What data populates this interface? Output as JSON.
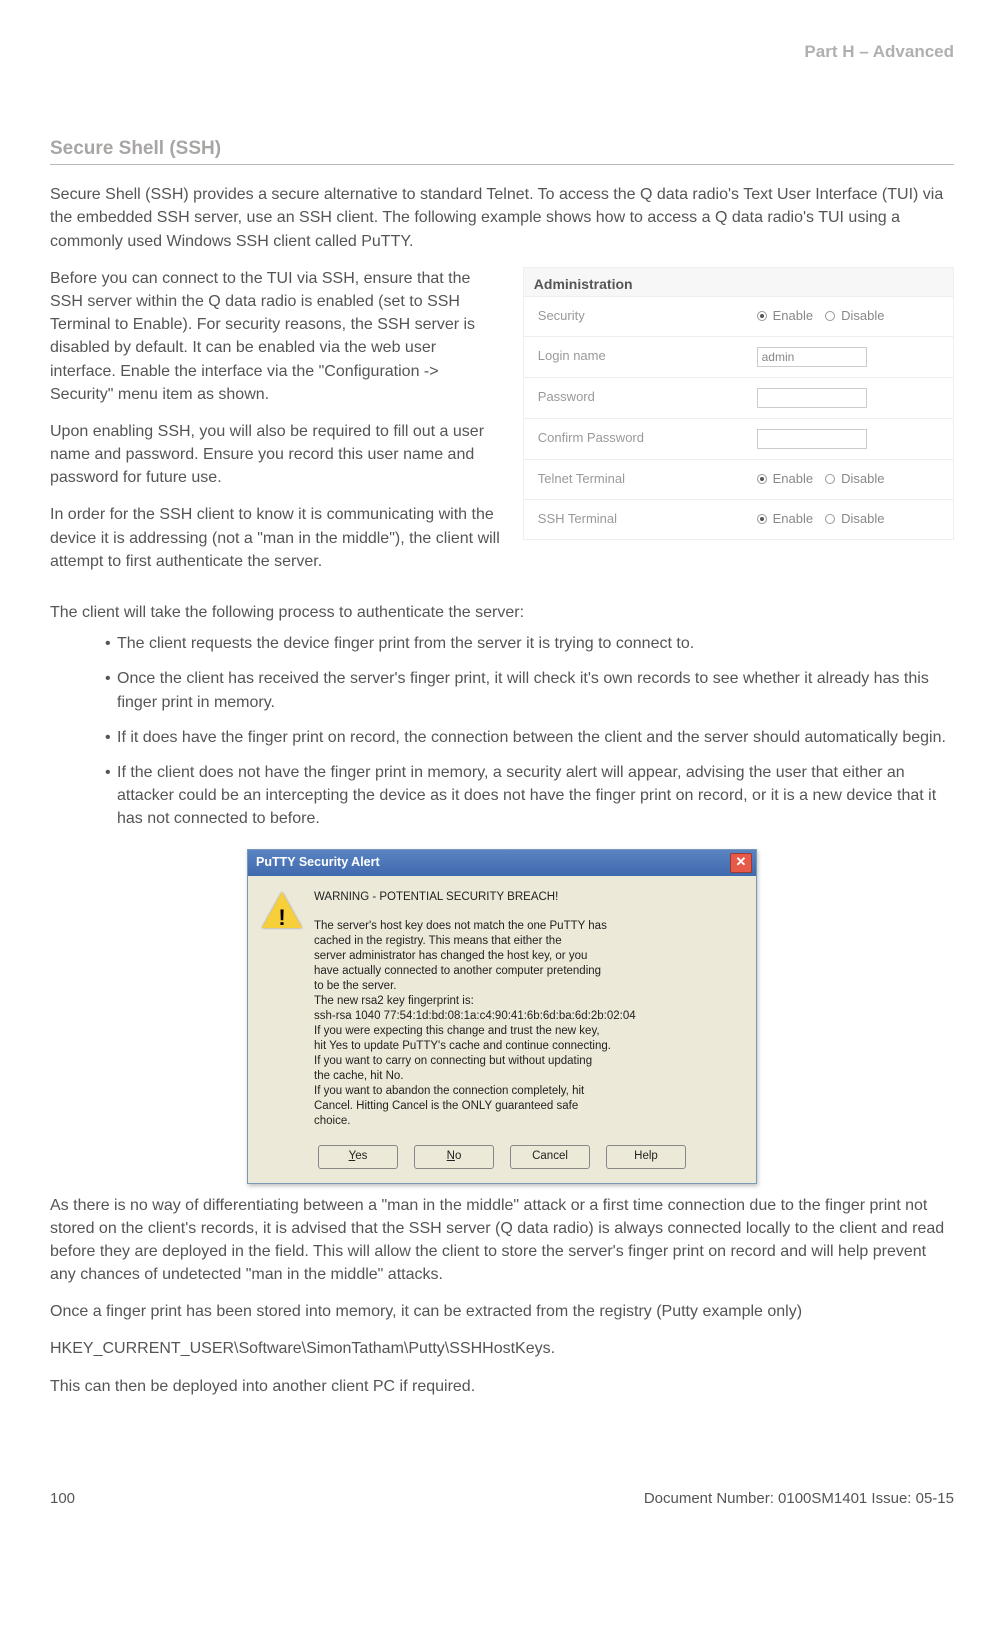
{
  "header": {
    "part": "Part H – Advanced"
  },
  "section": {
    "title": "Secure Shell (SSH)"
  },
  "paras": {
    "intro": "Secure Shell (SSH) provides a secure alternative to standard Telnet. To access the Q data radio's Text User Interface (TUI) via the embedded SSH server, use an SSH client. The following example shows how to access a Q data radio's TUI using a commonly used Windows SSH client called PuTTY.",
    "before": "Before you can connect to the TUI via SSH, ensure that the SSH server within the Q data radio is enabled (set to SSH Terminal to Enable). For security reasons, the SSH server is disabled by default. It can be enabled via the web user interface. Enable the interface via the \"Configuration -> Security\" menu item as shown.",
    "upon": "Upon enabling SSH, you will also be required to fill out a user name and password. Ensure you record this user name and password for future use.",
    "inorder": "In order for the SSH client to know it is communicating with the device it is addressing (not a \"man in the middle\"), the client will attempt to first authenticate the server.",
    "clientprocess": "The client will take the following process to authenticate the server:",
    "after1": "As there is no way of differentiating between a \"man in the middle\" attack or a first time connection due to the finger print not stored on the client's records, it is advised that the SSH server (Q data radio) is always connected locally to the client and read before they are deployed in the field. This will allow the client to store the server's finger print on record and will help prevent any chances of undetected \"man in the middle\" attacks.",
    "after2": "Once a finger print has been stored into memory, it can be extracted from the registry (Putty example only)",
    "regkey": "HKEY_CURRENT_USER\\Software\\SimonTatham\\Putty\\SSHHostKeys.",
    "after3": "This can then be deployed into another client PC if required."
  },
  "bullets": [
    "The client requests the device finger print from the server it is trying to connect to.",
    "Once the client has received the server's finger print, it will check it's own records to see whether it already has this finger print in memory.",
    "If it does have the finger print on record, the connection between the client and the server should automatically begin.",
    "If the client does not have the finger print in memory, a security alert will appear, advising the user that either an attacker could be an intercepting the device as it does not have the finger print on record, or it is a new device that it has not connected to before."
  ],
  "admin": {
    "title": "Administration",
    "rows": {
      "security": "Security",
      "login": "Login name",
      "login_value": "admin",
      "password": "Password",
      "confirm": "Confirm Password",
      "telnet": "Telnet Terminal",
      "ssh": "SSH Terminal"
    },
    "opts": {
      "enable": "Enable",
      "disable": "Disable"
    }
  },
  "putty": {
    "title": "PuTTY Security Alert",
    "warning": "WARNING - POTENTIAL SECURITY BREACH!",
    "l1": "The server's host key does not match the one PuTTY has",
    "l2": "cached in the registry. This means that either the",
    "l3": "server administrator has changed the host key, or you",
    "l4": "have actually connected to another computer pretending",
    "l5": "to be the server.",
    "l6": "The new rsa2 key fingerprint is:",
    "l7": "ssh-rsa 1040 77:54:1d:bd:08:1a:c4:90:41:6b:6d:ba:6d:2b:02:04",
    "l8": "If you were expecting this change and trust the new key,",
    "l9": "hit Yes to update PuTTY's cache and continue connecting.",
    "l10": "If you want to carry on connecting but without updating",
    "l11": "the cache, hit No.",
    "l12": "If you want to abandon the connection completely, hit",
    "l13": "Cancel. Hitting Cancel is the ONLY guaranteed safe",
    "l14": "choice.",
    "buttons": {
      "yes_u": "Y",
      "yes_r": "es",
      "no_u": "N",
      "no_r": "o",
      "cancel": "Cancel",
      "help": "Help"
    }
  },
  "footer": {
    "page": "100",
    "doc": "Document Number: 0100SM1401   Issue: 05-15"
  }
}
